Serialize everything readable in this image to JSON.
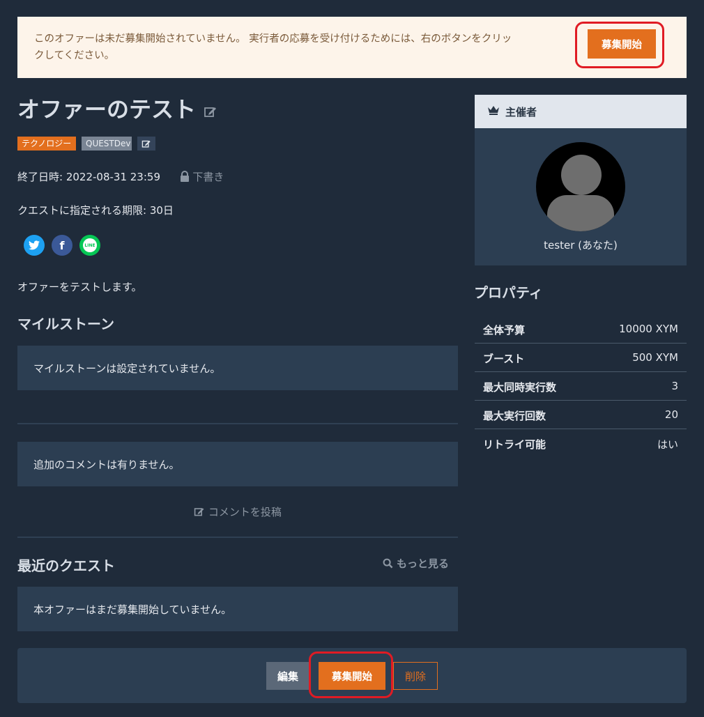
{
  "notice": {
    "text": "このオファーは未だ募集開始されていません。 実行者の応募を受け付けるためには、右のボタンをクリックしてください。",
    "button": "募集開始"
  },
  "offer": {
    "title": "オファーのテスト",
    "tags": [
      "テクノロジー",
      "QUESTDev"
    ],
    "end_label": "終了日時: 2022-08-31 23:59",
    "status": "下書き",
    "deadline": "クエストに指定される期限: 30日",
    "description": "オファーをテストします。"
  },
  "social": {
    "twitter_icon": "twitter-icon",
    "facebook_icon": "facebook-icon",
    "line_icon": "line-icon",
    "line_label": "LINE"
  },
  "milestones": {
    "heading": "マイルストーン",
    "empty": "マイルストーンは設定されていません。"
  },
  "comments": {
    "empty": "追加のコメントは有りません。",
    "post": "コメントを投稿"
  },
  "quests": {
    "heading": "最近のクエスト",
    "more": "もっと見る",
    "empty": "本オファーはまだ募集開始していません。"
  },
  "organizer": {
    "heading": "主催者",
    "name": "tester (あなた)"
  },
  "properties": {
    "heading": "プロパティ",
    "rows": [
      {
        "k": "全体予算",
        "v": "10000 XYM"
      },
      {
        "k": "ブースト",
        "v": "500 XYM"
      },
      {
        "k": "最大同時実行数",
        "v": "3"
      },
      {
        "k": "最大実行回数",
        "v": "20"
      },
      {
        "k": "リトライ可能",
        "v": "はい"
      }
    ]
  },
  "footer": {
    "edit": "編集",
    "start": "募集開始",
    "delete": "削除"
  },
  "colors": {
    "accent": "#e36f1e",
    "highlight": "#e01b24",
    "background": "#1f2b3a"
  }
}
